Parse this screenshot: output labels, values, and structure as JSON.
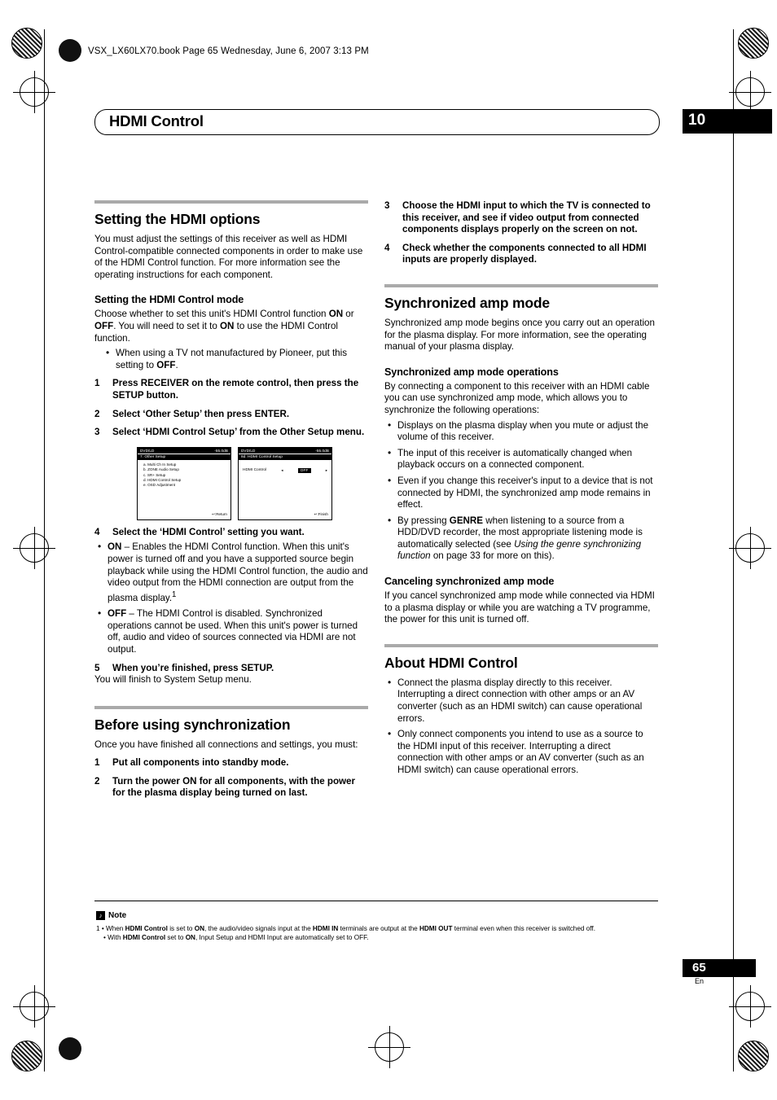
{
  "header": {
    "bookline": "VSX_LX60LX70.book  Page 65  Wednesday, June 6, 2007  3:13 PM",
    "title": "HDMI Control",
    "chapter": "10"
  },
  "left": {
    "s1_title": "Setting the HDMI options",
    "s1_p1": "You must adjust the settings of this receiver as well as HDMI Control-compatible connected components in order to make use of the HDMI Control function. For more information see the operating instructions for each component.",
    "s2_title": "Setting the HDMI Control mode",
    "s2_p1_a": "Choose whether to set this unit's HDMI Control function ",
    "s2_p1_on": "ON",
    "s2_p1_b": " or ",
    "s2_p1_off": "OFF",
    "s2_p1_c": ". You will need to set it to ",
    "s2_p1_on2": "ON",
    "s2_p1_d": " to use the HDMI Control function.",
    "s2_bullet_a": "When using a TV not manufactured by Pioneer, put this setting to ",
    "s2_bullet_off": "OFF",
    "s2_bullet_b": ".",
    "step1_n": "1",
    "step1_t": "Press RECEIVER on the remote control, then press the SETUP button.",
    "step2_n": "2",
    "step2_t": "Select ‘Other Setup’ then press ENTER.",
    "step3_n": "3",
    "step3_t": "Select ‘HDMI Control Setup’ from the Other Setup menu.",
    "osd1": {
      "bar_left": "DVD/LD",
      "bar_right": "-55.0dB",
      "title": "7. Other Setup",
      "items": [
        "a. Multi Ch In Setup",
        "b. ZONE Audio Setup",
        "c. SR+ Setup",
        "d. HDMI Control Setup",
        "e. OSD Adjustment"
      ],
      "highlight_index": 3,
      "footer": "↩:Return"
    },
    "osd2": {
      "bar_left": "DVD/LD",
      "bar_right": "-55.0dB",
      "title": "8d. HDMI Control Setup",
      "row_label": "HDMI Control",
      "row_value": "OFF",
      "footer": "↩:Finish"
    },
    "step4_n": "4",
    "step4_t": "Select the ‘HDMI Control’ setting you want.",
    "step4_b1_lead": "ON",
    "step4_b1_text": " – Enables the HDMI Control function. When this unit's power is turned off and you have a supported source begin playback while using the HDMI Control function, the audio and video output from the HDMI connection are output from the plasma display.",
    "step4_b1_sup": "1",
    "step4_b2_lead": "OFF",
    "step4_b2_text": " – The HDMI Control is disabled. Synchronized operations cannot be used. When this unit's power is turned off, audio and video of sources connected via HDMI are not output.",
    "step5_n": "5",
    "step5_t": "When you’re finished, press SETUP.",
    "step5_sub": "You will finish to System Setup menu.",
    "s3_title": "Before using synchronization",
    "s3_p1": "Once you have finished all connections and settings, you must:",
    "s3_step1_n": "1",
    "s3_step1_t": "Put all components into standby mode.",
    "s3_step2_n": "2",
    "s3_step2_t": "Turn the power ON for all components, with the power for the plasma display being turned on last."
  },
  "right": {
    "step3_n": "3",
    "step3_t": "Choose the HDMI input to which the TV is connected to this receiver, and see if video output from connected components displays properly on the screen on not.",
    "step4_n": "4",
    "step4_t": "Check whether the components connected to all HDMI inputs are properly displayed.",
    "s1_title": "Synchronized amp mode",
    "s1_p1": "Synchronized amp mode begins once you carry out an operation for the plasma display. For more information, see the operating manual of your plasma display.",
    "s2_title": "Synchronized amp mode operations",
    "s2_p1": "By connecting a component to this receiver with an HDMI cable you can use synchronized amp mode, which allows you to synchronize the following operations:",
    "s2_b1": "Displays on the plasma display when you mute or adjust the volume of this receiver.",
    "s2_b2": "The input of this receiver is automatically changed when playback occurs on a connected component.",
    "s2_b3": "Even if you change this receiver's input to a device that is not connected by HDMI, the synchronized amp mode remains in effect.",
    "s2_b4_a": "By pressing ",
    "s2_b4_genre": "GENRE",
    "s2_b4_b": " when listening to a source from a HDD/DVD recorder, the most appropriate listening mode is automatically selected (see ",
    "s2_b4_it": "Using the genre synchronizing function",
    "s2_b4_c": " on page 33 for more on this).",
    "s3_title": "Canceling synchronized amp mode",
    "s3_p1": "If you cancel synchronized amp mode while connected via HDMI to a plasma display or while you are watching a TV programme, the power for this unit is turned off.",
    "s4_title": "About HDMI Control",
    "s4_b1": "Connect the plasma display directly to this receiver. Interrupting a direct connection with other amps or an AV converter (such as an HDMI switch) can cause operational errors.",
    "s4_b2": "Only connect components you intend to use as a source to the HDMI input of this receiver. Interrupting a direct connection with other amps or an AV converter (such as an HDMI switch) can cause operational errors."
  },
  "note": {
    "label": "Note",
    "line1_a": "1 • When ",
    "line1_hdmi": "HDMI Control",
    "line1_b": " is set to ",
    "line1_on": "ON",
    "line1_c": ", the audio/video signals input at the ",
    "line1_in": "HDMI IN",
    "line1_d": " terminals are output at the ",
    "line1_out": "HDMI OUT",
    "line1_e": " terminal even when this receiver is switched off.",
    "line2_a": "• With ",
    "line2_hdmi": "HDMI Control",
    "line2_b": " set to ",
    "line2_on": "ON",
    "line2_c": ", Input Setup and HDMI Input are automatically set to OFF."
  },
  "footer": {
    "pagenum": "65",
    "lang": "En"
  }
}
